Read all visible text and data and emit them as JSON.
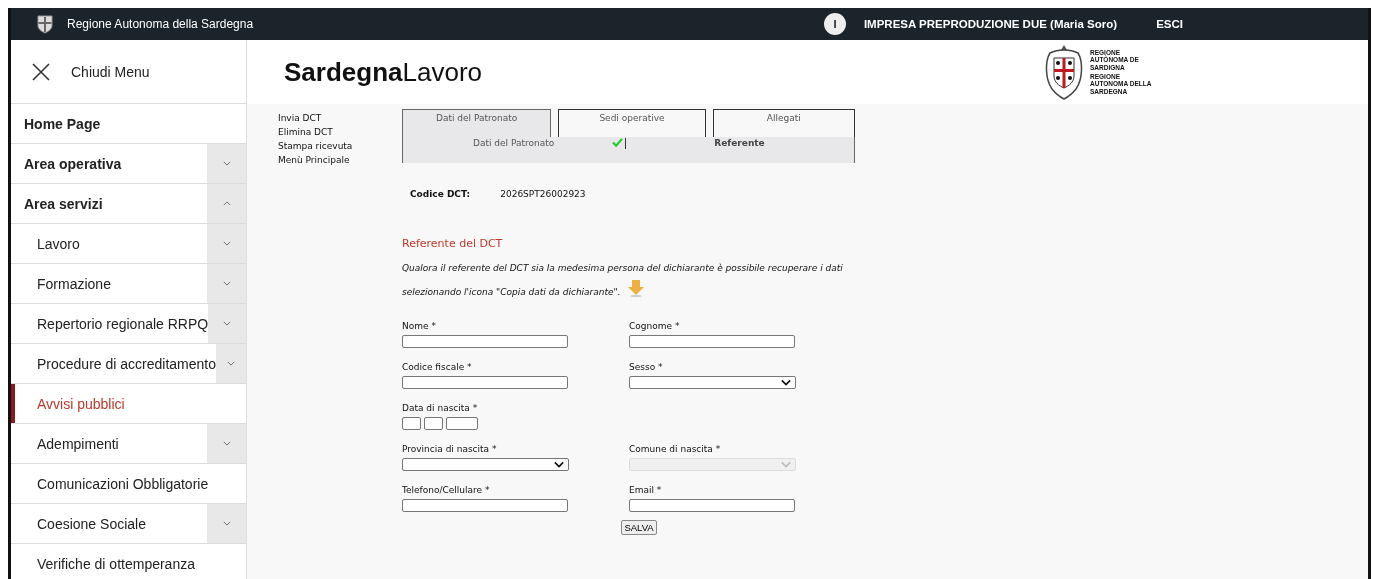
{
  "top_bar": {
    "site_name": "Regione Autonoma della Sardegna",
    "user_initial": "I",
    "user_name": "IMPRESA PREPRODUZIONE DUE (Maria Soro)",
    "logout": "ESCI"
  },
  "sidebar": {
    "close_label": "Chiudi Menu",
    "items": [
      {
        "label": "Home Page",
        "selected": false
      },
      {
        "label": "Area operativa",
        "selected": false,
        "expanded": false
      },
      {
        "label": "Area servizi",
        "selected": false,
        "expanded": true,
        "children": [
          {
            "label": "Lavoro",
            "selected": false,
            "expanded": false
          },
          {
            "label": "Formazione",
            "selected": false,
            "expanded": false
          },
          {
            "label": "Repertorio regionale RRPQ",
            "selected": false,
            "expanded": false
          },
          {
            "label": "Procedure di accreditamento",
            "selected": false,
            "expanded": false
          },
          {
            "label": "Avvisi pubblici",
            "selected": true
          },
          {
            "label": "Adempimenti",
            "selected": false,
            "expanded": false
          },
          {
            "label": "Comunicazioni Obbligatorie",
            "selected": false
          },
          {
            "label": "Coesione Sociale",
            "selected": false,
            "expanded": false
          },
          {
            "label": "Verifiche di ottemperanza",
            "selected": false
          }
        ]
      }
    ]
  },
  "header": {
    "title": "**Sardegna**Lavoro",
    "logo_text": [
      "REGIONE AUTÒNOMA DE SARDIGNA",
      "REGIONE AUTONOMA DELLA SARDEGNA"
    ]
  },
  "actions": [
    "Invia DCT",
    "Elimina DCT",
    "Stampa ricevuta",
    "Menù Principale"
  ],
  "tabs": [
    {
      "label": "Dati del Patronato",
      "selected": true
    },
    {
      "label": "Sedi operative",
      "selected": false
    },
    {
      "label": "Allegati",
      "selected": false
    }
  ],
  "subtabs": [
    {
      "label": "Dati del Patronato",
      "selected": false,
      "complete": true
    },
    {
      "label": "Referente",
      "selected": true
    }
  ],
  "code": {
    "label": "Codice DCT:",
    "value": "2026SPT26002923"
  },
  "section_title": "Referente del DCT",
  "note": "Qualora il referente del DCT sia la medesima persona del dichiarante è possibile recuperare i dati selezionando l'icona \"Copia dati da dichiarante\".",
  "form_rows": [
    [
      {
        "label": "Nome *",
        "kind": "text",
        "disabled": false
      },
      {
        "label": "Cognome *",
        "kind": "text",
        "disabled": false
      }
    ],
    [
      {
        "label": "Codice fiscale *",
        "kind": "text",
        "disabled": false
      },
      {
        "label": "Sesso *",
        "kind": "select",
        "disabled": false
      }
    ],
    [
      {
        "label": "Data di nascita *",
        "kind": "date",
        "disabled": false
      }
    ],
    [
      {
        "label": "Provincia di nascita *",
        "kind": "select",
        "disabled": false
      },
      {
        "label": "Comune di nascita *",
        "kind": "select",
        "disabled": true
      }
    ],
    [
      {
        "label": "Telefono/Cellulare *",
        "kind": "text",
        "disabled": false
      },
      {
        "label": "Email *",
        "kind": "text",
        "disabled": false
      }
    ]
  ],
  "save_button": "SALVA"
}
